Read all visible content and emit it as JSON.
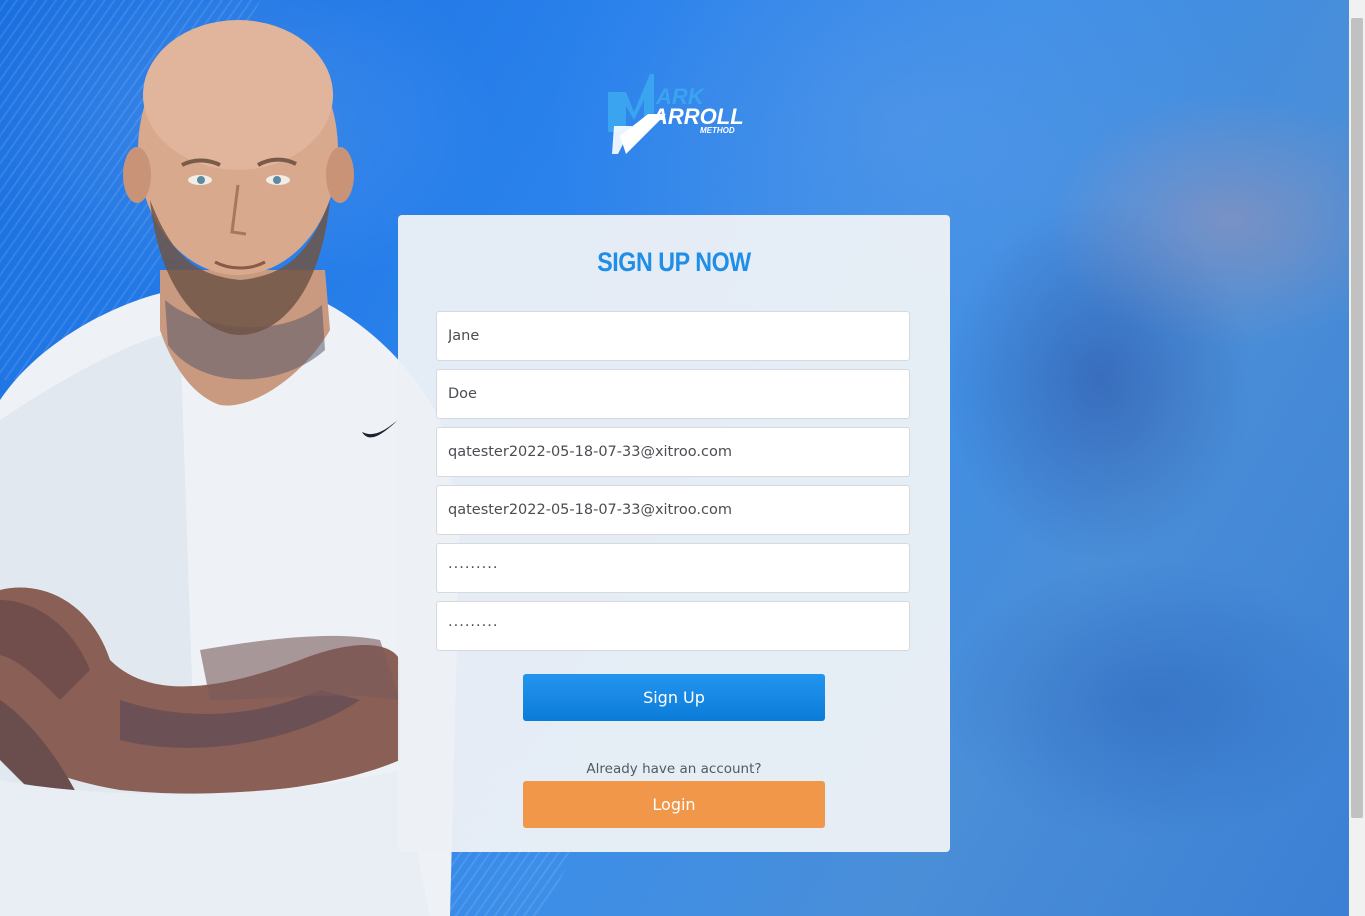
{
  "brand": {
    "logo_text_line1": "ARK",
    "logo_text_line2": "ARROLL",
    "logo_text_line3": "METHOD"
  },
  "form": {
    "title": "SIGN UP NOW",
    "first_name_value": "Jane",
    "last_name_value": "Doe",
    "email_value": "qatester2022-05-18-07-33@xitroo.com",
    "confirm_email_value": "qatester2022-05-18-07-33@xitroo.com",
    "password_value": "·········",
    "confirm_password_value": "·········",
    "signup_label": "Sign Up",
    "already_text": "Already have an account?",
    "login_label": "Login"
  },
  "colors": {
    "accent_blue": "#1f8ee6",
    "login_orange": "#f0974a",
    "background_blue": "#2a82ec"
  }
}
